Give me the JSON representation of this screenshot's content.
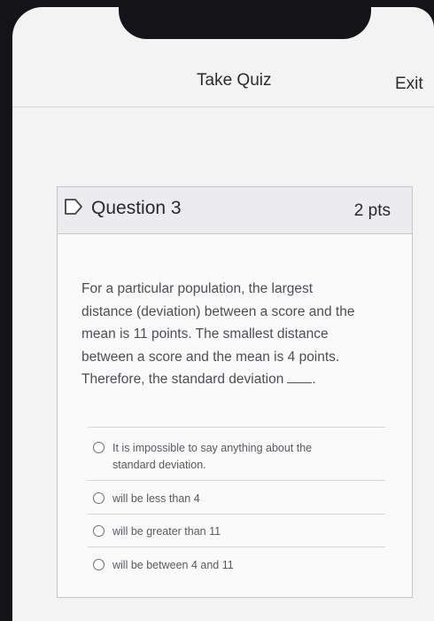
{
  "header": {
    "title": "Take Quiz",
    "exit_label": "Exit"
  },
  "question": {
    "title": "Question 3",
    "points": "2 pts",
    "text_line1": "For a particular population, the largest",
    "text_line2": "distance (deviation) between a score and the",
    "text_line3": "mean is 11 points. The smallest distance",
    "text_line4": "between a score and the mean is 4 points.",
    "text_line5": "Therefore, the standard deviation",
    "blank_suffix": "."
  },
  "options": [
    {
      "label_line1": "It is impossible to say anything about the",
      "label_line2": "standard deviation."
    },
    {
      "label_line1": "will be less than 4"
    },
    {
      "label_line1": "will be greater than 11"
    },
    {
      "label_line1": "will be between 4 and 11"
    }
  ],
  "icons": {
    "flag": "bookmark-flag-icon",
    "radio": "radio-button"
  },
  "colors": {
    "screen_bg": "#f3f3f4",
    "card_header_bg": "#ececee",
    "text_primary": "#2a2a2e",
    "text_secondary": "#4e4e56"
  }
}
